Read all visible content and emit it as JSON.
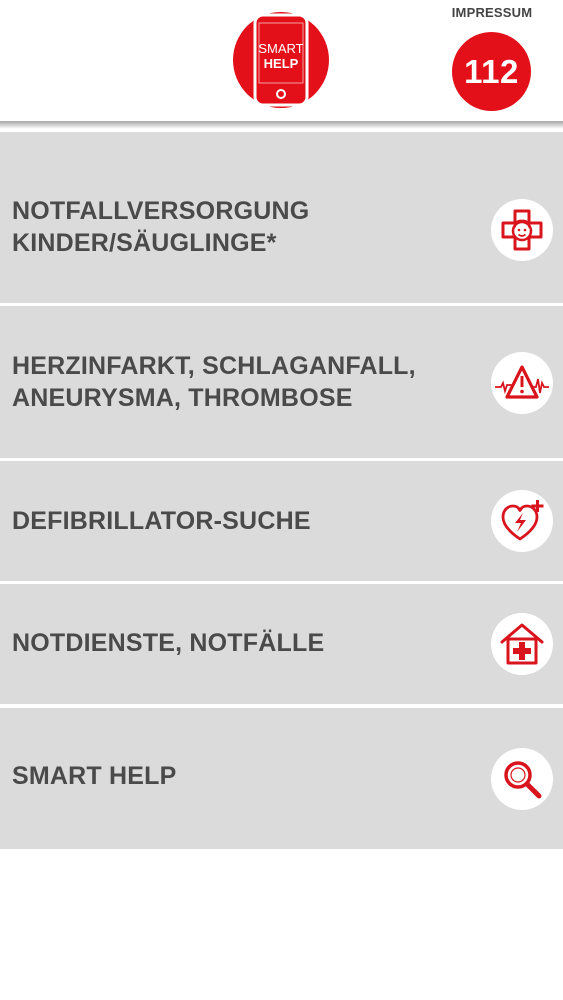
{
  "header": {
    "logo": {
      "line1": "SMART",
      "line2": "HELP",
      "icon": "smartphone-logo-icon"
    },
    "impressum_label": "IMPRESSUM",
    "emergency_number": "112"
  },
  "menu": {
    "items": [
      {
        "label_line1": "NOTFALLVERSORGUNG",
        "label_line2": "KINDER/SÄUGLINGE*",
        "icon": "child-cross-icon"
      },
      {
        "label_line1": "HERZINFARKT, SCHLAGANFALL,",
        "label_line2": "ANEURYSMA, THROMBOSE",
        "icon": "heartbeat-warning-icon"
      },
      {
        "label_line1": "DEFIBRILLATOR-SUCHE",
        "icon": "defibrillator-heart-icon"
      },
      {
        "label_line1": "NOTDIENSTE, NOTFÄLLE",
        "icon": "hospital-house-icon"
      },
      {
        "label_line1": "SMART HELP",
        "icon": "magnifier-icon"
      }
    ]
  },
  "colors": {
    "brand_red": "#e3101a",
    "menu_background": "#dbdbdb",
    "menu_text": "#4a4a4a"
  }
}
